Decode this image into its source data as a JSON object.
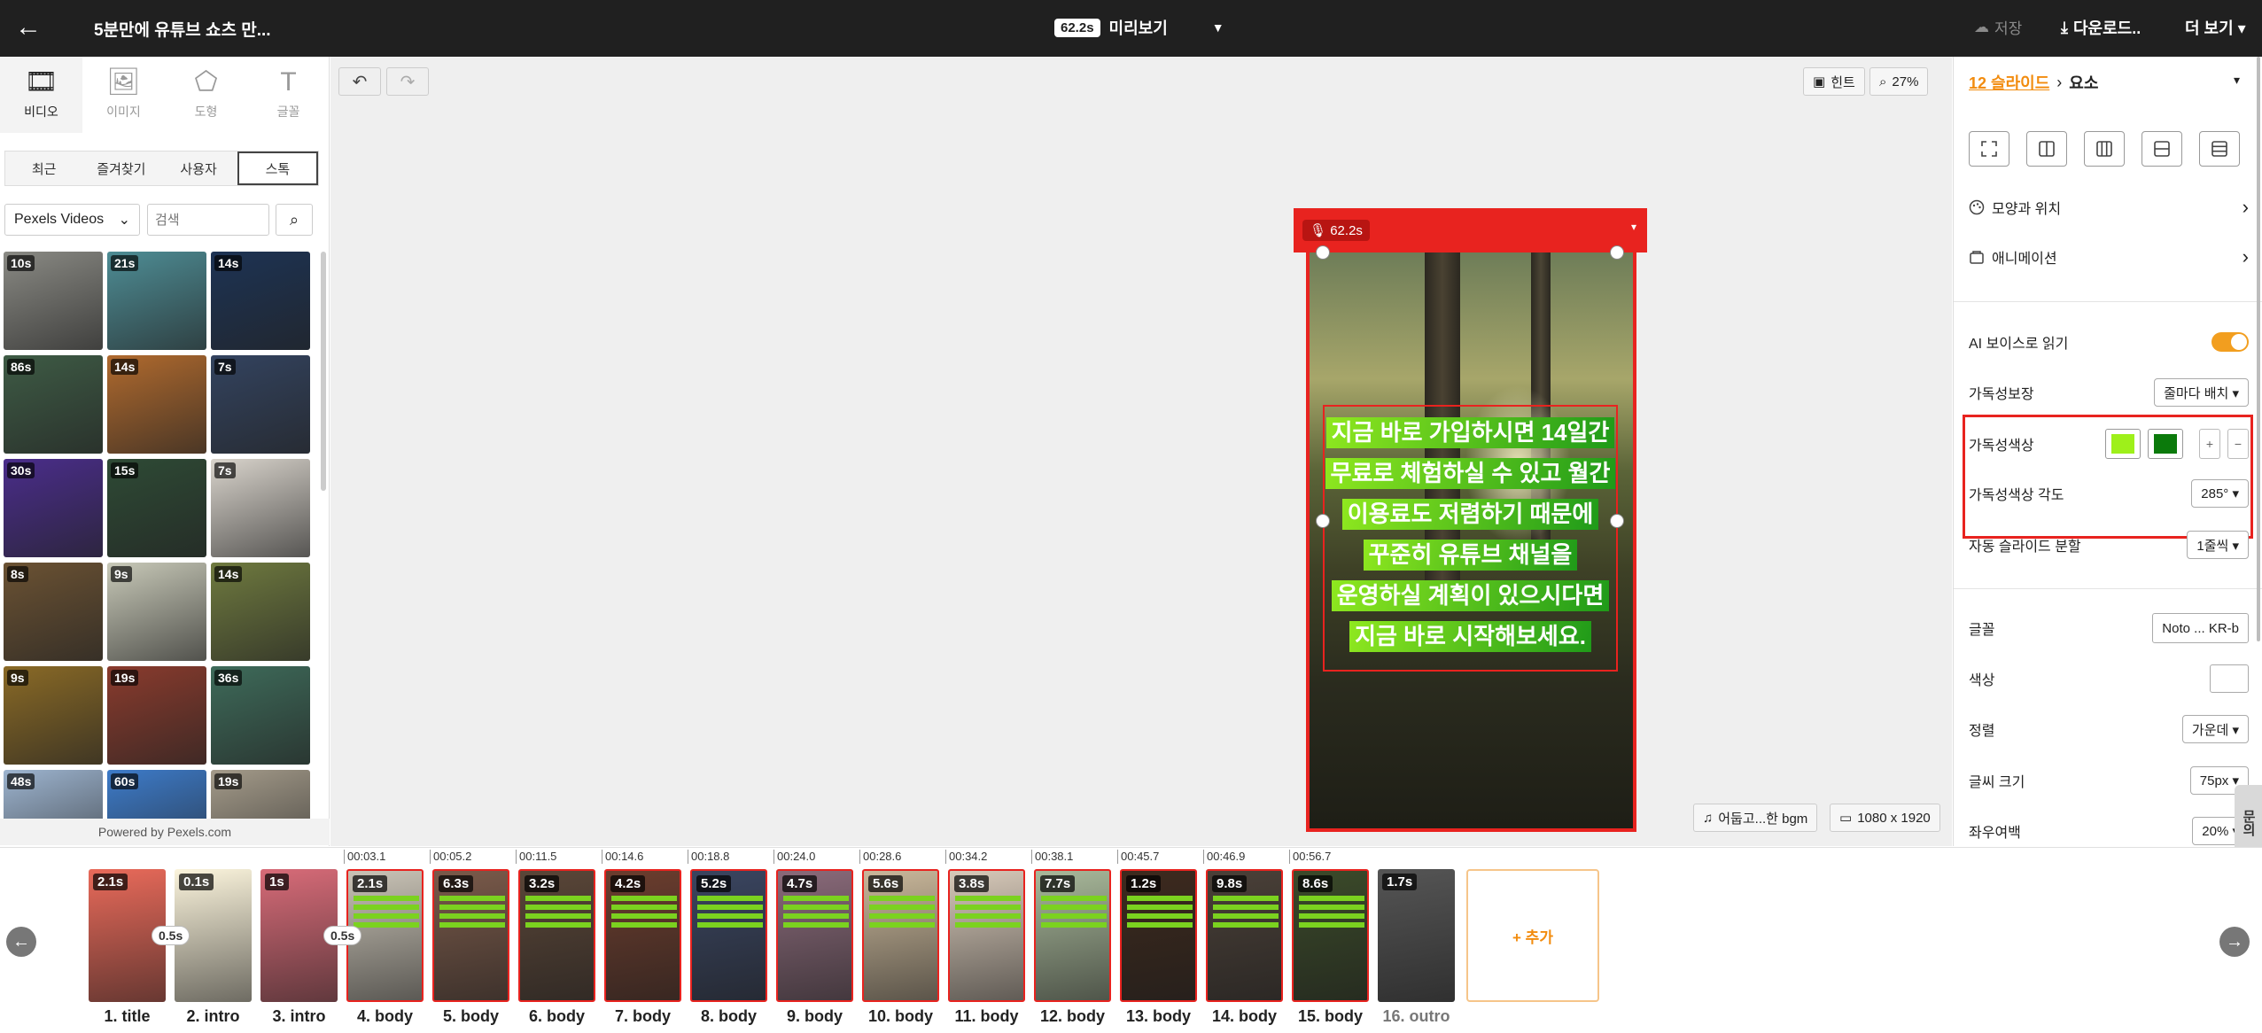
{
  "topbar": {
    "back_icon": "←",
    "title": "5분만에 유튜브 쇼츠 만...",
    "duration": "62.2s",
    "preview_label": "미리보기",
    "preview_caret": "▼",
    "save_label": "저장",
    "save_icon": "☁",
    "download_label": "다운로드..",
    "download_icon": "⤓",
    "more_label": "더 보기 ▾"
  },
  "left": {
    "tabs": [
      {
        "label": "비디오",
        "icon": "🎞"
      },
      {
        "label": "이미지",
        "icon": "🖼"
      },
      {
        "label": "도형",
        "icon": "⬠"
      },
      {
        "label": "글꼴",
        "icon": "T"
      }
    ],
    "source_tabs": [
      "최근",
      "즐겨찾기",
      "사용자",
      "스톡"
    ],
    "provider": "Pexels Videos",
    "provider_caret": "⌄",
    "search_placeholder": "검색",
    "search_icon": "⌕",
    "thumbs": [
      {
        "d": "10s",
        "bg": "#8a8a84"
      },
      {
        "d": "21s",
        "bg": "#4e8d95"
      },
      {
        "d": "14s",
        "bg": "#1d3354"
      },
      {
        "d": "86s",
        "bg": "#3e5b45"
      },
      {
        "d": "14s",
        "bg": "#b06a2e"
      },
      {
        "d": "7s",
        "bg": "#33435f"
      },
      {
        "d": "30s",
        "bg": "#4a2d8b"
      },
      {
        "d": "15s",
        "bg": "#2e4a35"
      },
      {
        "d": "7s",
        "bg": "#d9d4cc"
      },
      {
        "d": "8s",
        "bg": "#6b5233"
      },
      {
        "d": "9s",
        "bg": "#c8c9b8"
      },
      {
        "d": "14s",
        "bg": "#6f7a3f"
      },
      {
        "d": "9s",
        "bg": "#8a6a26"
      },
      {
        "d": "19s",
        "bg": "#8a3b2d"
      },
      {
        "d": "36s",
        "bg": "#3e6b5a"
      },
      {
        "d": "48s",
        "bg": "#9db4cf"
      },
      {
        "d": "60s",
        "bg": "#3d7bc9"
      },
      {
        "d": "19s",
        "bg": "#a49b8a"
      }
    ],
    "powered": "Powered by Pexels.com"
  },
  "canvas": {
    "undo_icon": "↶",
    "redo_icon": "↷",
    "hint_label": "힌트",
    "hint_icon": "▣",
    "zoom_label": "27%",
    "zoom_icon": "⌕",
    "bgm_label": "어둡고...한 bgm",
    "bgm_icon": "♫",
    "resolution": "1080 x 1920",
    "resolution_icon": "▭",
    "preview_duration": "62.2s",
    "mic_icon": "🎙",
    "preview_caret": "▾",
    "caption_lines": [
      "지금 바로 가입하시면 14일간",
      "무료로 체험하실 수 있고 월간",
      "이용료도 저렴하기 때문에",
      "꾸준히 유튜브 채널을",
      "운영하실 계획이 있으시다면",
      "지금 바로 시작해보세요."
    ]
  },
  "right": {
    "breadcrumb_link": "12 슬라이드",
    "breadcrumb_sep": "›",
    "breadcrumb_current": "요소",
    "caret": "▾",
    "shape_pos_label": "모양과 위치",
    "animation_label": "애니메이션",
    "chevron": "›",
    "ai_voice_label": "AI 보이스로 읽기",
    "ai_voice_on": true,
    "readability_label": "가독성보장",
    "readability_value": "줄마다 배치 ▾",
    "readability_color_label": "가독성색상",
    "color1": "#9ef01a",
    "color2": "#0b7a0b",
    "plus": "+",
    "minus": "−",
    "angle_label": "가독성색상 각도",
    "angle_value": "285° ▾",
    "auto_split_label": "자동 슬라이드 분할",
    "auto_split_value": "1줄씩 ▾",
    "font_label": "글꼴",
    "font_value": "Noto ... KR-b",
    "color_label": "색상",
    "align_label": "정렬",
    "align_value": "가운데 ▾",
    "size_label": "글씨 크기",
    "size_value": "75px ▾",
    "margin_label": "좌우여백",
    "margin_value": "20% ▾",
    "side_tab": "문의"
  },
  "timeline": {
    "left_arrow": "←",
    "right_arrow": "→",
    "ruler": [
      "00:03.1",
      "00:05.2",
      "00:11.5",
      "00:14.6",
      "00:18.8",
      "00:24.0",
      "00:28.6",
      "00:34.2",
      "00:38.1",
      "00:45.7",
      "00:46.9",
      "00:56.7"
    ],
    "slides": [
      {
        "d": "2.1s",
        "label": "1. title",
        "bg": "#e96a5a"
      },
      {
        "d": "0.1s",
        "label": "2. intro",
        "bg": "#fbf4dc"
      },
      {
        "d": "1s",
        "label": "3. intro",
        "bg": "#d76b78"
      },
      {
        "d": "2.1s",
        "label": "4. body",
        "bg": "#c9c3b6"
      },
      {
        "d": "6.3s",
        "label": "5. body",
        "bg": "#7a5a4a"
      },
      {
        "d": "3.2s",
        "label": "6. body",
        "bg": "#5a4638"
      },
      {
        "d": "4.2s",
        "label": "7. body",
        "bg": "#6b3d2e"
      },
      {
        "d": "5.2s",
        "label": "8. body",
        "bg": "#3a4560"
      },
      {
        "d": "4.7s",
        "label": "9. body",
        "bg": "#8a6a7a"
      },
      {
        "d": "5.6s",
        "label": "10. body",
        "bg": "#c9b79a"
      },
      {
        "d": "3.8s",
        "label": "11. body",
        "bg": "#d7c9b9"
      },
      {
        "d": "7.7s",
        "label": "12. body",
        "bg": "#a8b89a"
      },
      {
        "d": "1.2s",
        "label": "13. body",
        "bg": "#3d2a1e"
      },
      {
        "d": "9.8s",
        "label": "14. body",
        "bg": "#4a4038"
      },
      {
        "d": "8.6s",
        "label": "15. body",
        "bg": "#3b4a2a"
      },
      {
        "d": "1.7s",
        "label": "16. outro",
        "bg": "#555555"
      }
    ],
    "transitions": [
      "0.5s",
      "0.5s"
    ],
    "add_label": "+ 추가"
  }
}
